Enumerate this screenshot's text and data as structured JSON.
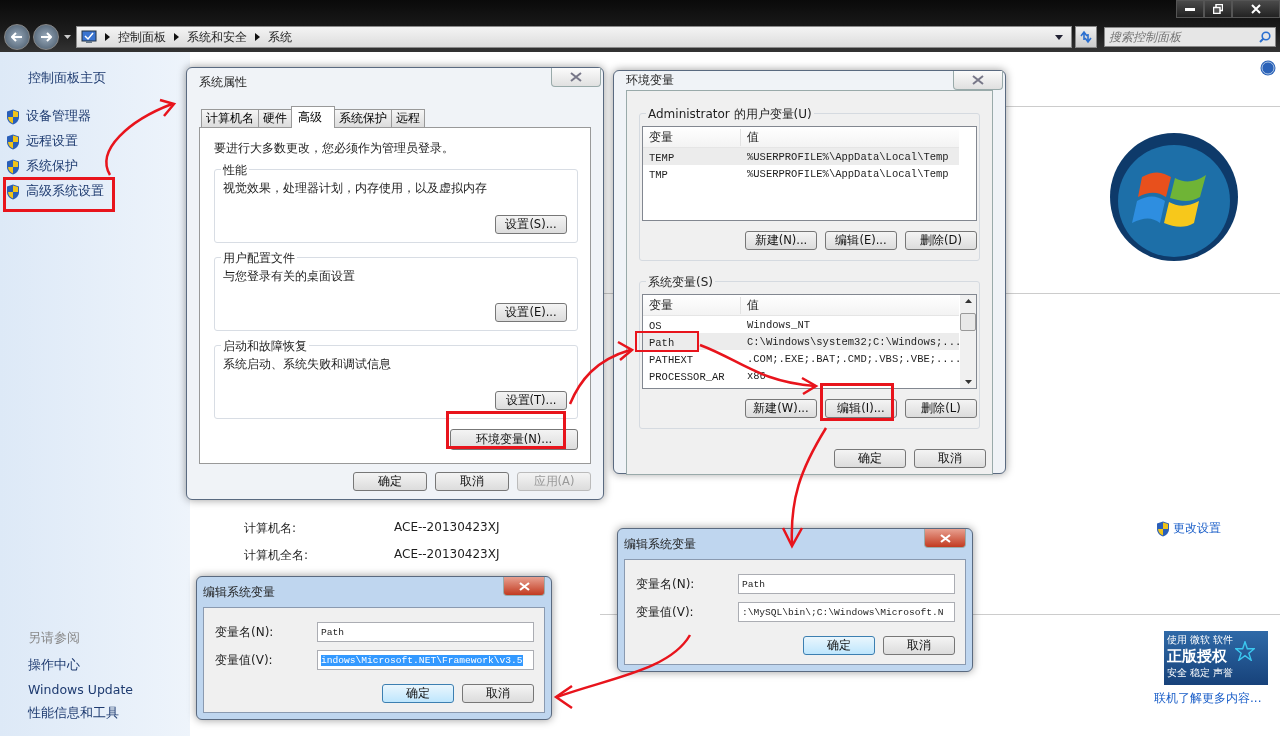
{
  "window": {
    "breadcrumb": [
      "控制面板",
      "系统和安全",
      "系统"
    ],
    "search": {
      "placeholder": "搜索控制面板"
    }
  },
  "sidebar": {
    "home": "控制面板主页",
    "items": [
      "设备管理器",
      "远程设置",
      "系统保护",
      "高级系统设置"
    ],
    "see_also_heading": "另请参阅",
    "see_also": [
      "操作中心",
      "Windows Update",
      "性能信息和工具"
    ]
  },
  "computer": [
    {
      "label": "计算机名:",
      "value": "ACE--20130423XJ"
    },
    {
      "label": "计算机全名:",
      "value": "ACE--20130423XJ"
    }
  ],
  "change_settings": "更改设置",
  "genuine_badge": {
    "line_1": [
      "使用",
      "微软",
      "软件"
    ],
    "title": "正版授权",
    "line_3": [
      "安全",
      "稳定",
      "声誉"
    ]
  },
  "more_link": "联机了解更多内容...",
  "system_properties": {
    "title": "系统属性",
    "tabs": [
      {
        "label": "计算机名",
        "selected": false
      },
      {
        "label": "硬件",
        "selected": false
      },
      {
        "label": "高级",
        "selected": true
      },
      {
        "label": "系统保护",
        "selected": false
      },
      {
        "label": "远程",
        "selected": false
      }
    ],
    "notice": "要进行大多数更改，您必须作为管理员登录。",
    "groups": [
      {
        "title": "性能",
        "description": "视觉效果，处理器计划，内存使用，以及虚拟内存",
        "button": "设置(S)..."
      },
      {
        "title": "用户配置文件",
        "description": "与您登录有关的桌面设置",
        "button": "设置(E)..."
      },
      {
        "title": "启动和故障恢复",
        "description": "系统启动、系统失败和调试信息",
        "button": "设置(T)..."
      }
    ],
    "env_button": "环境变量(N)...",
    "buttons": [
      {
        "label": "确定",
        "disabled": false
      },
      {
        "label": "取消",
        "disabled": false
      },
      {
        "label": "应用(A)",
        "disabled": true
      }
    ]
  },
  "environment_variables": {
    "title": "环境变量",
    "groups": [
      {
        "title": "Administrator 的用户变量(U)",
        "columns": [
          "变量",
          "值"
        ],
        "rows": [
          {
            "name": "TEMP",
            "value": "%USERPROFILE%\\AppData\\Local\\Temp",
            "selected": true
          },
          {
            "name": "TMP",
            "value": "%USERPROFILE%\\AppData\\Local\\Temp",
            "selected": false
          }
        ],
        "buttons": [
          "新建(N)...",
          "编辑(E)...",
          "删除(D)"
        ]
      },
      {
        "title": "系统变量(S)",
        "columns": [
          "变量",
          "值"
        ],
        "rows": [
          {
            "name": "OS",
            "value": "Windows_NT",
            "selected": false
          },
          {
            "name": "Path",
            "value": "C:\\Windows\\system32;C:\\Windows;...",
            "selected": true,
            "annotated": true
          },
          {
            "name": "PATHEXT",
            "value": ".COM;.EXE;.BAT;.CMD;.VBS;.VBE;....",
            "selected": false
          },
          {
            "name": "PROCESSOR_AR",
            "value": "x86",
            "selected": false
          }
        ],
        "buttons": [
          "新建(W)...",
          "编辑(I)...",
          "删除(L)"
        ]
      }
    ],
    "buttons": [
      "确定",
      "取消"
    ]
  },
  "edit_dialogs": [
    {
      "title": "编辑系统变量",
      "fields": [
        {
          "label": "变量名(N):",
          "value": "Path",
          "selected": false
        },
        {
          "label": "变量值(V):",
          "value": ":\\MySQL\\bin\\;C:\\Windows\\Microsoft.N",
          "selected": false
        }
      ],
      "buttons": [
        {
          "label": "确定",
          "default": true
        },
        {
          "label": "取消",
          "default": false
        }
      ]
    },
    {
      "title": "编辑系统变量",
      "fields": [
        {
          "label": "变量名(N):",
          "value": "Path",
          "selected": false
        },
        {
          "label": "变量值(V):",
          "value": "indows\\Microsoft.NET\\Framework\\v3.5",
          "selected": true
        }
      ],
      "buttons": [
        {
          "label": "确定",
          "default": true
        },
        {
          "label": "取消",
          "default": false
        }
      ]
    }
  ]
}
